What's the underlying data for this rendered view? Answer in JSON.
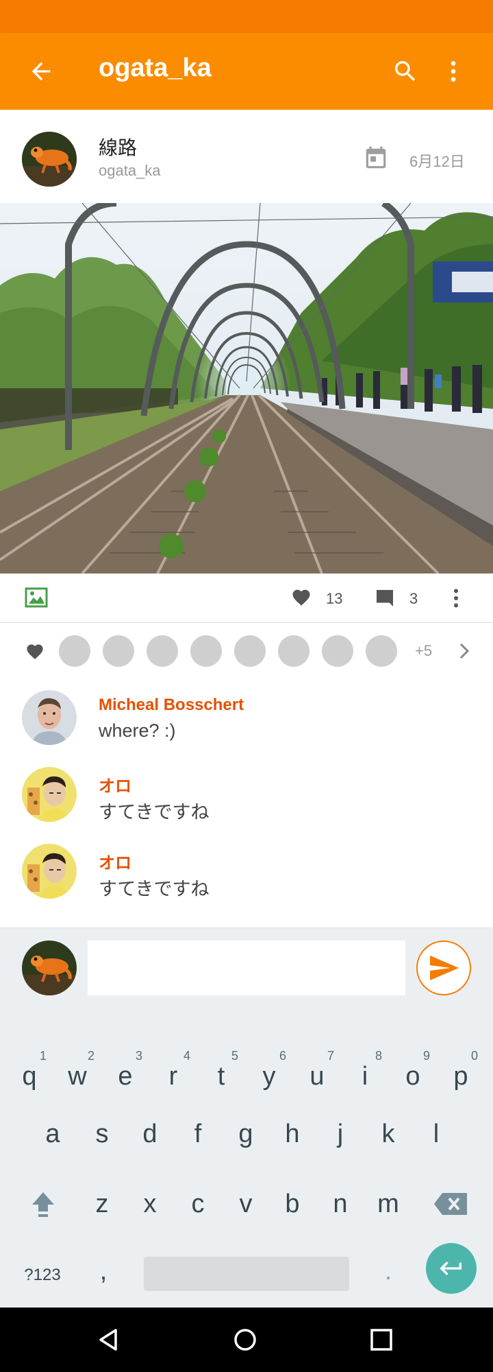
{
  "appbar": {
    "title": "ogata_ka"
  },
  "post": {
    "title": "線路",
    "username": "ogata_ka",
    "date": "6月12日",
    "like_count": "13",
    "comment_count": "3"
  },
  "likers": {
    "more_count": "+5"
  },
  "comments": [
    {
      "name": "Micheal Bosschert",
      "text": "where? :)"
    },
    {
      "name": "オロ",
      "text": "すてきですね"
    },
    {
      "name": "オロ",
      "text": "すてきですね"
    }
  ],
  "compose": {
    "value": "",
    "placeholder": ""
  },
  "keyboard": {
    "row1": [
      {
        "key": "q",
        "hint": "1"
      },
      {
        "key": "w",
        "hint": "2"
      },
      {
        "key": "e",
        "hint": "3"
      },
      {
        "key": "r",
        "hint": "4"
      },
      {
        "key": "t",
        "hint": "5"
      },
      {
        "key": "y",
        "hint": "6"
      },
      {
        "key": "u",
        "hint": "7"
      },
      {
        "key": "i",
        "hint": "8"
      },
      {
        "key": "o",
        "hint": "9"
      },
      {
        "key": "p",
        "hint": "0"
      }
    ],
    "row2": [
      "a",
      "s",
      "d",
      "f",
      "g",
      "h",
      "j",
      "k",
      "l"
    ],
    "row3": [
      "z",
      "x",
      "c",
      "v",
      "b",
      "n",
      "m"
    ],
    "symbols_label": "?123",
    "comma": ",",
    "period": "."
  },
  "colors": {
    "accent": "#fb8c00",
    "status_bar": "#f57c00",
    "commenter_name": "#e65100",
    "enter_key": "#4db6ac"
  }
}
